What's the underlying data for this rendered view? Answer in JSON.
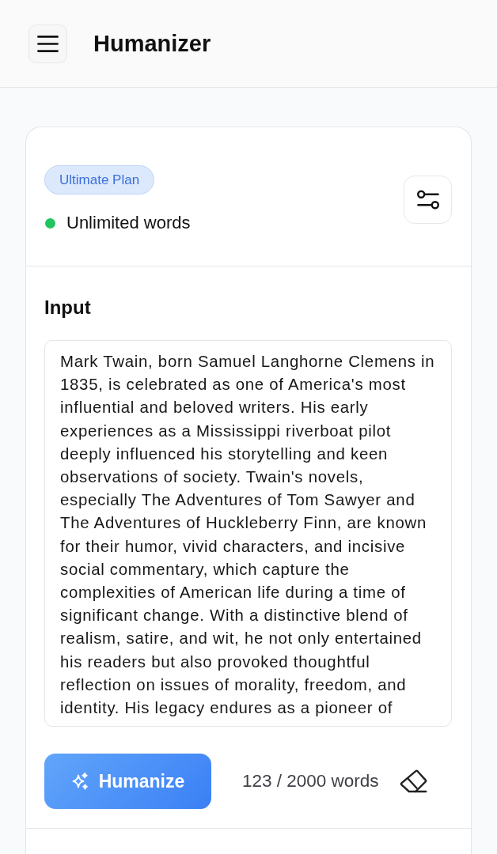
{
  "header": {
    "title": "Humanizer"
  },
  "plan": {
    "badge": "Ultimate Plan",
    "status": "Unlimited words"
  },
  "input": {
    "label": "Input",
    "value": "Mark Twain, born Samuel Langhorne Clemens in 1835, is celebrated as one of America's most influential and beloved writers. His early experiences as a Mississippi riverboat pilot deeply influenced his storytelling and keen observations of society. Twain's novels, especially The Adventures of Tom Sawyer and The Adventures of Huckleberry Finn, are known for their humor, vivid characters, and incisive social commentary, which capture the complexities of American life during a time of significant change. With a distinctive blend of realism, satire, and wit, he not only entertained his readers but also provoked thoughtful reflection on issues of morality, freedom, and identity. His legacy endures as a pioneer of"
  },
  "actions": {
    "button": "Humanize",
    "word_count": "123 / 2000 words"
  }
}
